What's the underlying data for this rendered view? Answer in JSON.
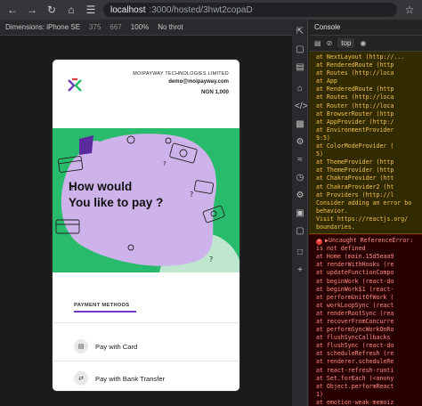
{
  "browser": {
    "url_host": "localhost",
    "url_path": ":3000/hosted/3hwt2copaD",
    "nav_icons": [
      "back-icon",
      "forward-icon",
      "reload-icon",
      "home-icon",
      "tune-icon"
    ]
  },
  "device_toolbar": {
    "dimensions_label": "Dimensions: iPhone SE",
    "width": "375",
    "height": "667",
    "zoom": "100%",
    "throttle": "No throt"
  },
  "app": {
    "company": "MOIPAYWAY TECHNOLOGIES LIMITED",
    "email": "demo@moipayway.com",
    "amount": "NGN 1,000",
    "hero_title_line1": "How would",
    "hero_title_line2": "You like to pay ?",
    "tab_label": "PAYMENT METHODS",
    "methods": [
      {
        "label": "Pay with Card",
        "icon": "card-icon"
      },
      {
        "label": "Pay with Bank Transfer",
        "icon": "transfer-icon"
      }
    ],
    "colors": {
      "hero_green": "#28bb6b",
      "blob_purple": "#cdb3ea",
      "accent": "#6f3bbf"
    }
  },
  "devtools": {
    "panel_title": "Console",
    "context": "top",
    "warn_lines": [
      "at NextLayout (http://...",
      "at RenderedRoute (http",
      "at Routes (http://loca",
      "at App",
      "at RenderedRoute (http",
      "at Routes (http://loca",
      "at Router (http://loca",
      "at BrowserRouter (http",
      "at AppProvider (http:/",
      "at EnvironmentProvider",
      "9:5)",
      "at ColorModeProvider (",
      "5)",
      "at ThemeProvider (http",
      "at ThemeProvider (http",
      "at ChakraProvider (htt",
      "at ChakraProvider2 (ht",
      "at Providers (http://l",
      "",
      "Consider adding an error bo",
      "behavior.",
      "Visit https://reactjs.org/",
      "boundaries."
    ],
    "error_lines": [
      "▶Uncaught ReferenceError:",
      "is not defined",
      "at Home (main.15d5eaa9",
      "at renderWithHooks (re",
      "at updateFunctionCompo",
      "at beginWork (react-do",
      "at beginWork$1 (react-",
      "at performUnitOfWork (",
      "at workLoopSync (react",
      "at renderRootSync (rea",
      "at recoverFromConcurre",
      "at performSyncWorkOnRo",
      "at flushSyncCallbacks",
      "at flushSync (react-do",
      "at scheduleRefresh (re",
      "at renderer.scheduleRe",
      "at react-refresh-runti",
      "at Set.forEach (<anony",
      "at Object.performReact",
      "1)",
      "at emotion-weak-memoiz"
    ]
  }
}
